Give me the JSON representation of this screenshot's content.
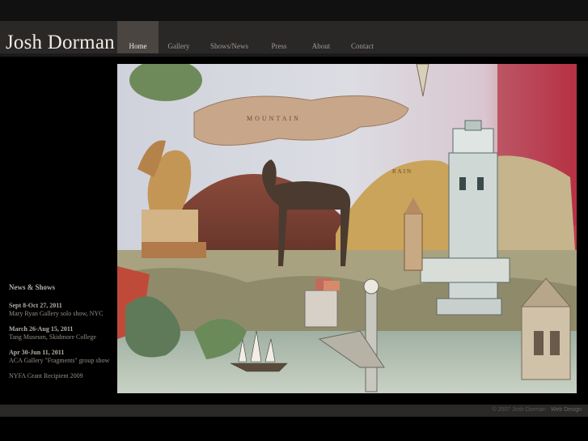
{
  "site": {
    "name": "Josh Dorman"
  },
  "nav": {
    "items": [
      {
        "label": "Home",
        "active": true
      },
      {
        "label": "Gallery",
        "active": false
      },
      {
        "label": "Shows/News",
        "active": false
      },
      {
        "label": "Press",
        "active": false
      },
      {
        "label": "About",
        "active": false
      },
      {
        "label": "Contact",
        "active": false
      }
    ]
  },
  "news": {
    "title": "News & Shows",
    "items": [
      {
        "date": "Sept 8-Oct 27, 2011",
        "text": "Mary Ryan Gallery solo show, NYC"
      },
      {
        "date": "March 26-Aug 15, 2011",
        "text": "Tang Museum, Skidmore College"
      },
      {
        "date": "Apr 30-Jun 11, 2011",
        "text": "ACA Gallery \"Fragments\" group show"
      },
      {
        "date": "",
        "text": "NYFA Grant Recipient 2009"
      }
    ]
  },
  "painting": {
    "map_word_1": "MOUNTAIN",
    "map_word_2": "RAIN"
  },
  "footer": {
    "copyright": "© 2007 Josh Dorman",
    "separator": "·",
    "credit": "Web Design"
  }
}
